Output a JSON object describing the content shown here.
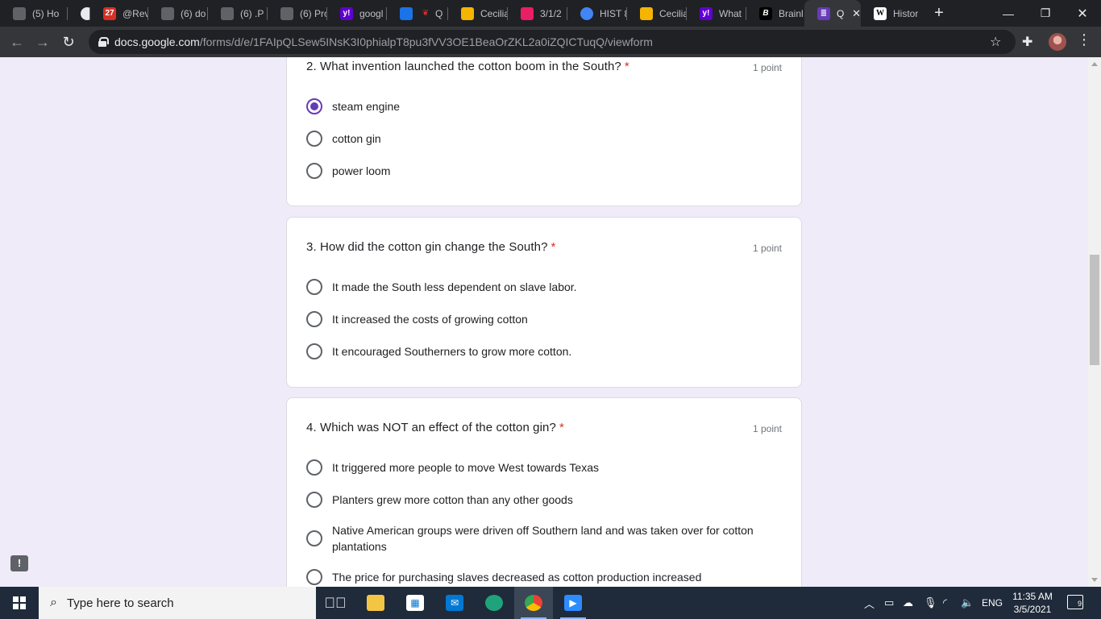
{
  "browser": {
    "tabs": [
      {
        "title": "(5) Ho",
        "icon": "doc-icon",
        "color": "#5f6368"
      },
      {
        "title": "",
        "icon": "circle-icon",
        "color": "#e8eaed"
      },
      {
        "title": "@Rev",
        "icon": "calendar-icon",
        "color": "#d93025",
        "badge": "27"
      },
      {
        "title": "(6) do",
        "icon": "doc-icon",
        "color": "#5f6368"
      },
      {
        "title": "(6) .P",
        "icon": "doc-icon",
        "color": "#5f6368"
      },
      {
        "title": "(6) Pro",
        "icon": "doc-icon",
        "color": "#5f6368"
      },
      {
        "title": "googl",
        "icon": "yahoo-icon",
        "color": "#6001d2",
        "badge": "y!"
      },
      {
        "title": "Q",
        "icon": "contact-icon",
        "color": "#1a73e8"
      },
      {
        "title": "Cecilia",
        "icon": "slides-icon",
        "color": "#f4b400"
      },
      {
        "title": "3/1/2",
        "icon": "user-icon",
        "color": "#e91e63"
      },
      {
        "title": "HIST 8",
        "icon": "globe-icon",
        "color": "#4285f4"
      },
      {
        "title": "Cecilia",
        "icon": "slides-icon",
        "color": "#f4b400"
      },
      {
        "title": "What",
        "icon": "yahoo-icon",
        "color": "#6001d2",
        "badge": "y!"
      },
      {
        "title": "Brainl",
        "icon": "brainly-icon",
        "color": "#000000",
        "badge": "B"
      },
      {
        "title": "Q",
        "icon": "forms-icon",
        "color": "#673ab7",
        "active": true
      },
      {
        "title": "Histor",
        "icon": "wikipedia-icon",
        "color": "#ffffff",
        "badge": "W"
      }
    ],
    "url_host": "docs.google.com",
    "url_path": "/forms/d/e/1FAIpQLSew5INsK3I0phialpT8pu3fVV3OE1BeaOrZKL2a0iZQICTuqQ/viewform"
  },
  "form": {
    "questions": [
      {
        "title": "2. What invention launched the cotton boom in the South?",
        "required_mark": "*",
        "points": "1 point",
        "options": [
          "steam engine",
          "cotton gin",
          "power loom"
        ],
        "selected": 0
      },
      {
        "title": "3. How did the cotton gin change the South?",
        "required_mark": "*",
        "points": "1 point",
        "options": [
          "It made the South less dependent on slave labor.",
          "It increased the costs of growing cotton",
          "It encouraged Southerners to grow more cotton."
        ]
      },
      {
        "title": "4. Which was NOT an effect of the cotton gin?",
        "required_mark": "*",
        "points": "1 point",
        "options": [
          "It triggered more people to move West towards Texas",
          "Planters grew more cotton than any other goods",
          "Native American groups were driven off Southern land and was taken over for cotton plantations",
          "The price for purchasing slaves decreased as cotton production increased"
        ]
      }
    ]
  },
  "feedback": {
    "label": "!"
  },
  "taskbar": {
    "search_placeholder": "Type here to search",
    "language": "ENG",
    "time": "11:35 AM",
    "date": "3/5/2021",
    "notification_count": "9"
  },
  "colors": {
    "accent": "#673ab7",
    "required": "#d93025",
    "page_bg": "#f0ebf8"
  }
}
